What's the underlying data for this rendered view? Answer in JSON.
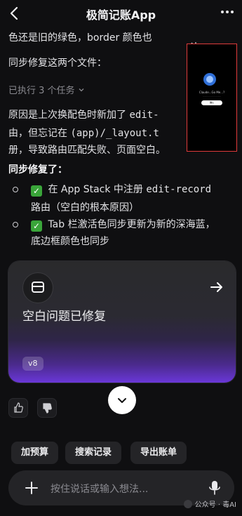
{
  "header": {
    "title": "极简记账App"
  },
  "lines": {
    "l0": "色还是旧的绿色，border 颜色也",
    "l1": "同步修复这两个文件：",
    "l3a": "原因是上次换配色时新加了 ",
    "l3b": "edit-",
    "l4a": "由，但忘记在 ",
    "l4b": "(app)/_layout.t",
    "l5": "册，导致路由匹配失败、页面空白。",
    "l6": "同步修复了：",
    "b1a": " 在 App Stack 中注册 ",
    "b1b": "edit-record",
    "b1c": "路由（空白的根本原因）",
    "b2a": " Tab 栏激活色同步更新为新的深海蓝，",
    "b2b": "底边框颜色也同步"
  },
  "tasks": {
    "label": "已执行 3 个任务"
  },
  "thumbnail": {
    "line1": "Claude...Go Me...?",
    "line2": "............................",
    "button": "确认"
  },
  "card": {
    "title": "空白问题已修复",
    "badge": "v8"
  },
  "chips": [
    "加预算",
    "搜索记录",
    "导出账单"
  ],
  "input": {
    "placeholder": "按住说话或输入想法..."
  },
  "watermark": "公众号 · 毒AI",
  "colors": {
    "accent": "#6a37d8",
    "check": "#3aa53a",
    "highlight": "#e03b3b"
  }
}
